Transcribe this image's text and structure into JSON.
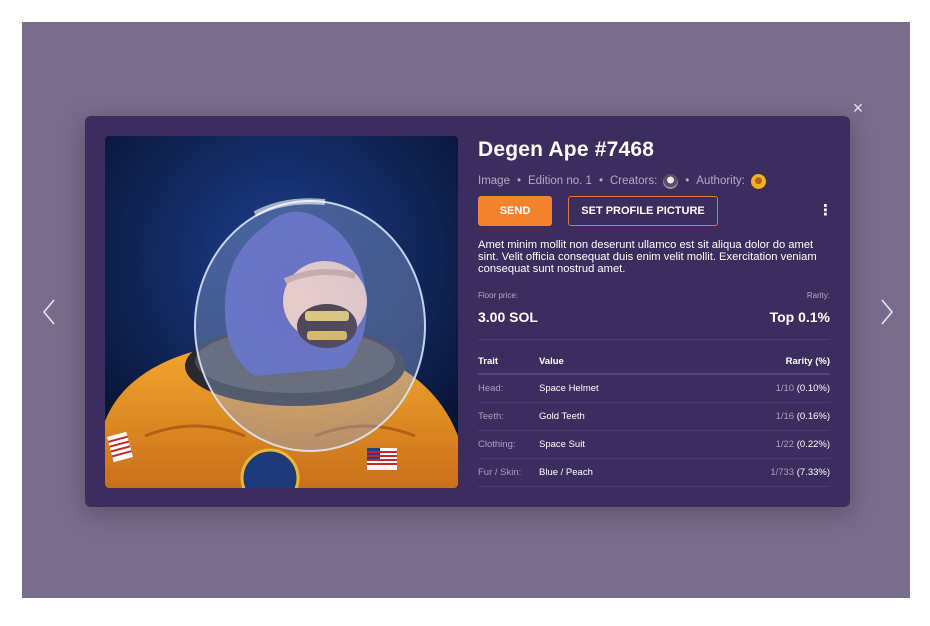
{
  "nft": {
    "title": "Degen Ape #7468",
    "type": "Image",
    "edition": "Edition no. 1",
    "creators_label": "Creators:",
    "authority_label": "Authority:",
    "description": "Amet minim mollit non deserunt ullamco est sit aliqua dolor do amet sint. Velit officia consequat duis enim velit mollit. Exercitation veniam consequat sunt nostrud amet."
  },
  "actions": {
    "send_label": "SEND",
    "profile_label": "SET PROFILE PICTURE",
    "more_icon": "⋮"
  },
  "stats": {
    "floor_label": "Floor price:",
    "floor_value": "3.00 SOL",
    "rarity_label": "Rarity:",
    "rarity_value": "Top 0.1%"
  },
  "traits": {
    "headers": {
      "trait": "Trait",
      "value": "Value",
      "rarity": "Rarity (%)"
    },
    "rows": [
      {
        "trait": "Head:",
        "value": "Space Helmet",
        "count": "1/10",
        "pct": "(0.10%)"
      },
      {
        "trait": "Teeth:",
        "value": "Gold Teeth",
        "count": "1/16",
        "pct": "(0.16%)"
      },
      {
        "trait": "Clothing:",
        "value": "Space Suit",
        "count": "1/22",
        "pct": "(0.22%)"
      },
      {
        "trait": "Fur / Skin:",
        "value": "Blue / Peach",
        "count": "1/733",
        "pct": "(7.33%)"
      }
    ]
  },
  "icons": {
    "close": "close-icon",
    "prev": "chevron-left-icon",
    "next": "chevron-right-icon",
    "close_glyph": "×"
  },
  "colors": {
    "backdrop": "#776c8b",
    "modal": "#3b2d5d",
    "accent": "#f5822d"
  }
}
